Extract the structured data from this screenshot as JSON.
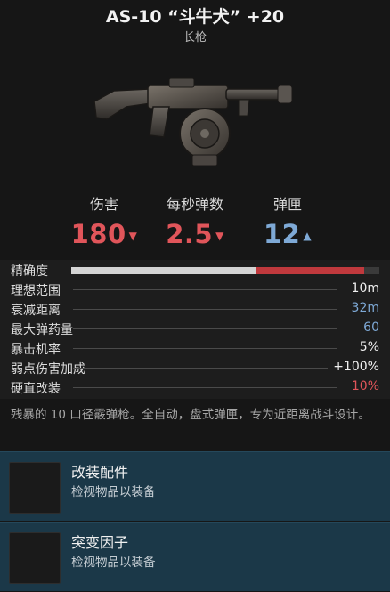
{
  "weapon": {
    "title": "AS-10 “斗牛犬” +20",
    "class": "长枪",
    "image_icon": "drum-shotgun-icon"
  },
  "primary_stats": [
    {
      "label": "伤害",
      "value": "180",
      "trend": "down",
      "color": "#e0555a"
    },
    {
      "label": "每秒弹数",
      "value": "2.5",
      "trend": "down",
      "color": "#e0555a"
    },
    {
      "label": "弹匣",
      "value": "12",
      "trend": "up",
      "color": "#7ea9d6"
    }
  ],
  "stats": {
    "accuracy": {
      "label": "精确度",
      "base_fraction": 0.6,
      "penalty_fraction": 0.35
    },
    "rows": [
      {
        "label": "理想范围",
        "value": "10m",
        "color": "#f0f0f0"
      },
      {
        "label": "衰减距离",
        "value": "32m",
        "color": "#7ea9d6"
      },
      {
        "label": "最大弹药量",
        "value": "60",
        "color": "#7ea9d6"
      },
      {
        "label": "暴击机率",
        "value": "5%",
        "color": "#f0f0f0"
      },
      {
        "label": "弱点伤害加成",
        "value": "+100%",
        "color": "#f0f0f0"
      },
      {
        "label": "硬直改装",
        "value": "10%",
        "color": "#e0555a"
      }
    ]
  },
  "description": "残暴的 10 口径霰弹枪。全自动，盘式弹匣，专为近距离战斗设计。",
  "slots": [
    {
      "title": "改装配件",
      "subtitle": "检视物品以装备"
    },
    {
      "title": "突变因子",
      "subtitle": "检视物品以装备"
    }
  ]
}
